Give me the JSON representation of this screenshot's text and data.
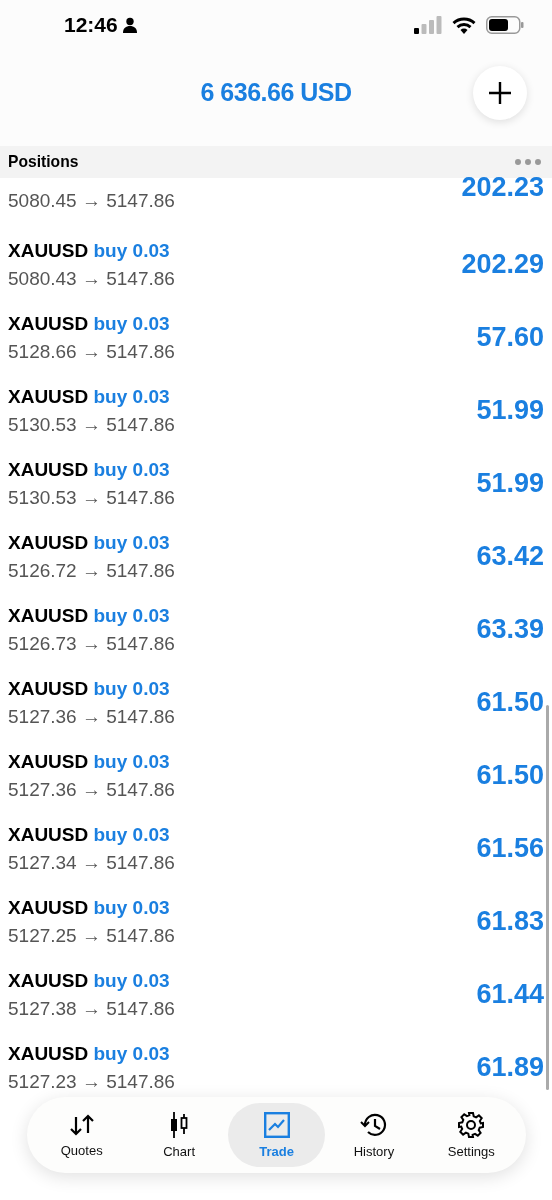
{
  "status_bar": {
    "time": "12:46"
  },
  "header": {
    "balance": "6 636.66 USD"
  },
  "section": {
    "title": "Positions"
  },
  "partial_row": {
    "prices": "5080.45 → 5147.86",
    "profit": "202.23"
  },
  "positions": [
    {
      "symbol": "XAUUSD",
      "side": "buy 0.03",
      "prices": "5080.43 → 5147.86",
      "profit": "202.29"
    },
    {
      "symbol": "XAUUSD",
      "side": "buy 0.03",
      "prices": "5128.66 → 5147.86",
      "profit": "57.60"
    },
    {
      "symbol": "XAUUSD",
      "side": "buy 0.03",
      "prices": "5130.53 → 5147.86",
      "profit": "51.99"
    },
    {
      "symbol": "XAUUSD",
      "side": "buy 0.03",
      "prices": "5130.53 → 5147.86",
      "profit": "51.99"
    },
    {
      "symbol": "XAUUSD",
      "side": "buy 0.03",
      "prices": "5126.72 → 5147.86",
      "profit": "63.42"
    },
    {
      "symbol": "XAUUSD",
      "side": "buy 0.03",
      "prices": "5126.73 → 5147.86",
      "profit": "63.39"
    },
    {
      "symbol": "XAUUSD",
      "side": "buy 0.03",
      "prices": "5127.36 → 5147.86",
      "profit": "61.50"
    },
    {
      "symbol": "XAUUSD",
      "side": "buy 0.03",
      "prices": "5127.36 → 5147.86",
      "profit": "61.50"
    },
    {
      "symbol": "XAUUSD",
      "side": "buy 0.03",
      "prices": "5127.34 → 5147.86",
      "profit": "61.56"
    },
    {
      "symbol": "XAUUSD",
      "side": "buy 0.03",
      "prices": "5127.25 → 5147.86",
      "profit": "61.83"
    },
    {
      "symbol": "XAUUSD",
      "side": "buy 0.03",
      "prices": "5127.38 → 5147.86",
      "profit": "61.44"
    },
    {
      "symbol": "XAUUSD",
      "side": "buy 0.03",
      "prices": "5127.23 → 5147.86",
      "profit": "61.89"
    }
  ],
  "nav": [
    {
      "label": "Quotes",
      "selected": false
    },
    {
      "label": "Chart",
      "selected": false
    },
    {
      "label": "Trade",
      "selected": true
    },
    {
      "label": "History",
      "selected": false
    },
    {
      "label": "Settings",
      "selected": false
    }
  ]
}
